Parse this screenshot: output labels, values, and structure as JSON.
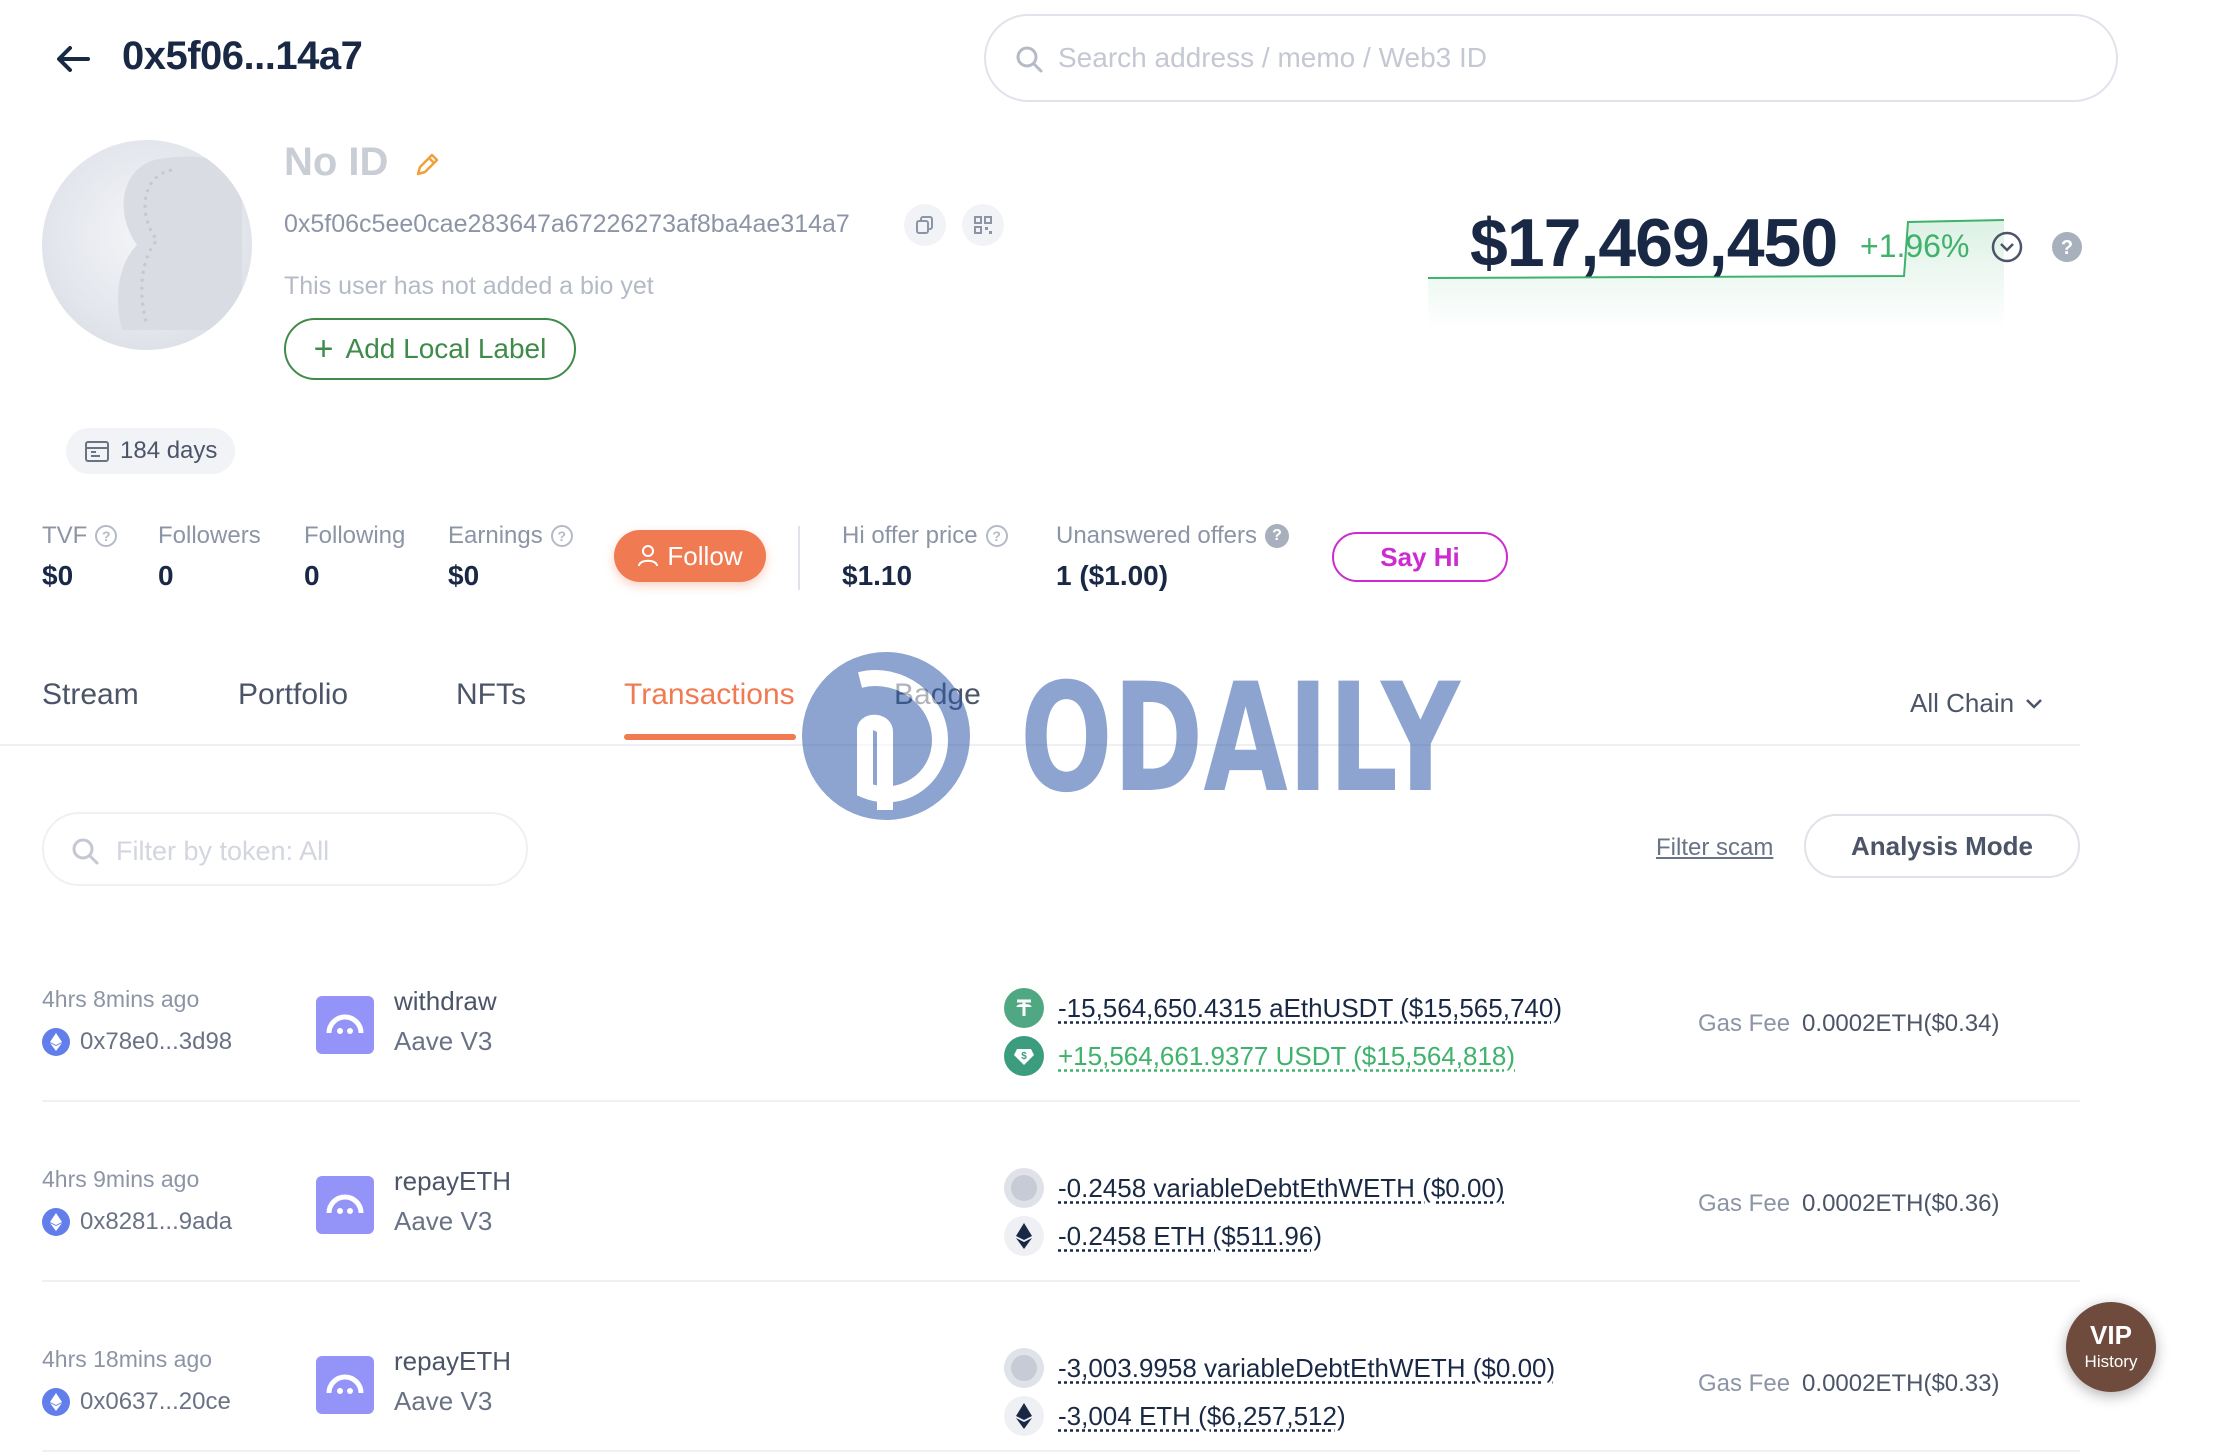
{
  "header": {
    "title": "0x5f06...14a7",
    "search_placeholder": "Search address / memo / Web3 ID"
  },
  "profile": {
    "name": "No ID",
    "address": "0x5f06c5ee0cae283647a67226273af8ba4ae314a7",
    "bio": "This user has not added a bio yet",
    "add_label": "Add Local Label",
    "days": "184 days",
    "balance": "$17,469,450",
    "balance_change": "+1.96%"
  },
  "stats": {
    "tvf_label": "TVF",
    "tvf_value": "$0",
    "followers_label": "Followers",
    "followers_value": "0",
    "following_label": "Following",
    "following_value": "0",
    "earnings_label": "Earnings",
    "earnings_value": "$0",
    "follow_button": "Follow",
    "hi_offer_label": "Hi offer price",
    "hi_offer_value": "$1.10",
    "unanswered_label": "Unanswered offers",
    "unanswered_value": "1 ($1.00)",
    "say_hi_button": "Say Hi"
  },
  "tabs": [
    "Stream",
    "Portfolio",
    "NFTs",
    "Transactions",
    "Badge"
  ],
  "active_tab": "Transactions",
  "chain_filter": "All Chain",
  "filter": {
    "placeholder": "Filter by token: All",
    "filter_scam": "Filter scam",
    "analysis_mode": "Analysis Mode"
  },
  "transactions": [
    {
      "time": "4hrs 8mins ago",
      "hash": "0x78e0...3d98",
      "method": "withdraw",
      "protocol": "Aave V3",
      "tokens": [
        {
          "amount": "-15,564,650.4315 aEthUSDT ($15,565,740)",
          "icon": "aethusdt-icon",
          "positive": false
        },
        {
          "amount": "+15,564,661.9377 USDT ($15,564,818)",
          "icon": "usdt-icon",
          "positive": true
        }
      ],
      "gas_label": "Gas Fee",
      "gas_value": "0.0002ETH($0.34)"
    },
    {
      "time": "4hrs 9mins ago",
      "hash": "0x8281...9ada",
      "method": "repayETH",
      "protocol": "Aave V3",
      "tokens": [
        {
          "amount": "-0.2458 variableDebtEthWETH ($0.00)",
          "icon": "debt-token-icon",
          "positive": false
        },
        {
          "amount": "-0.2458 ETH ($511.96)",
          "icon": "eth-icon",
          "positive": false
        }
      ],
      "gas_label": "Gas Fee",
      "gas_value": "0.0002ETH($0.36)"
    },
    {
      "time": "4hrs 18mins ago",
      "hash": "0x0637...20ce",
      "method": "repayETH",
      "protocol": "Aave V3",
      "tokens": [
        {
          "amount": "-3,003.9958 variableDebtEthWETH ($0.00)",
          "icon": "debt-token-icon",
          "positive": false
        },
        {
          "amount": "-3,004 ETH ($6,257,512)",
          "icon": "eth-icon",
          "positive": false
        }
      ],
      "gas_label": "Gas Fee",
      "gas_value": "0.0002ETH($0.33)"
    }
  ],
  "watermark": "ODAILY",
  "vip": {
    "title": "VIP",
    "subtitle": "History"
  },
  "colors": {
    "accent": "#f07a51",
    "positive": "#3fb26c",
    "say_hi": "#cc2bd0",
    "label_green": "#3f8b4a",
    "aave": "#9493f7"
  }
}
